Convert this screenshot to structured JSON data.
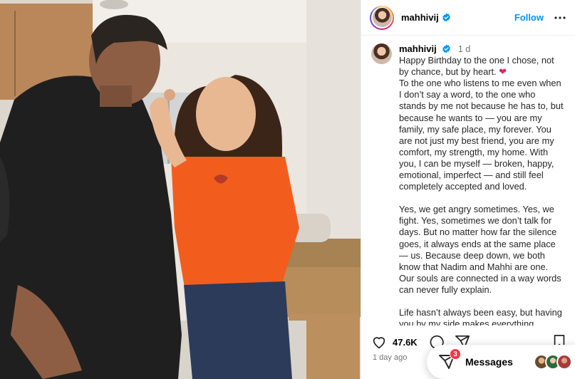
{
  "post": {
    "username": "mahhivij",
    "follow_label": "Follow"
  },
  "caption": {
    "username": "mahhivij",
    "time": "1 d",
    "para1": "Happy Birthday to the one I chose, not by chance, but by heart.",
    "heart": "❤",
    "para1b": "To the one who listens to me even when I don’t say a word, to the one who stands by me not because he has to, but because he wants to — you are my family, my safe place, my forever. You are not just my best friend, you are my comfort, my strength, my home. With you, I can be myself — broken, happy, emotional, imperfect — and still feel completely accepted and loved.",
    "para2": "Yes, we get angry sometimes. Yes, we fight. Yes, sometimes we don’t talk for days. But no matter how far the silence goes, it always ends at the same place — us. Because deep down, we both know that Nadim and Mahhi are one. Our souls are connected in a way words can never fully explain.",
    "para3": "Life hasn’t always been easy, but having you by my side makes everything"
  },
  "actions": {
    "likes": "47.6K",
    "date": "1 day ago"
  },
  "messages": {
    "label": "Messages",
    "badge": "3"
  },
  "icons": [
    "verified-icon",
    "more-icon",
    "heart-icon",
    "comment-icon",
    "share-icon",
    "bookmark-icon",
    "messages-icon"
  ],
  "colors": {
    "follow": "#0095f6",
    "verified": "#0095f6",
    "badge": "#ff3040"
  }
}
